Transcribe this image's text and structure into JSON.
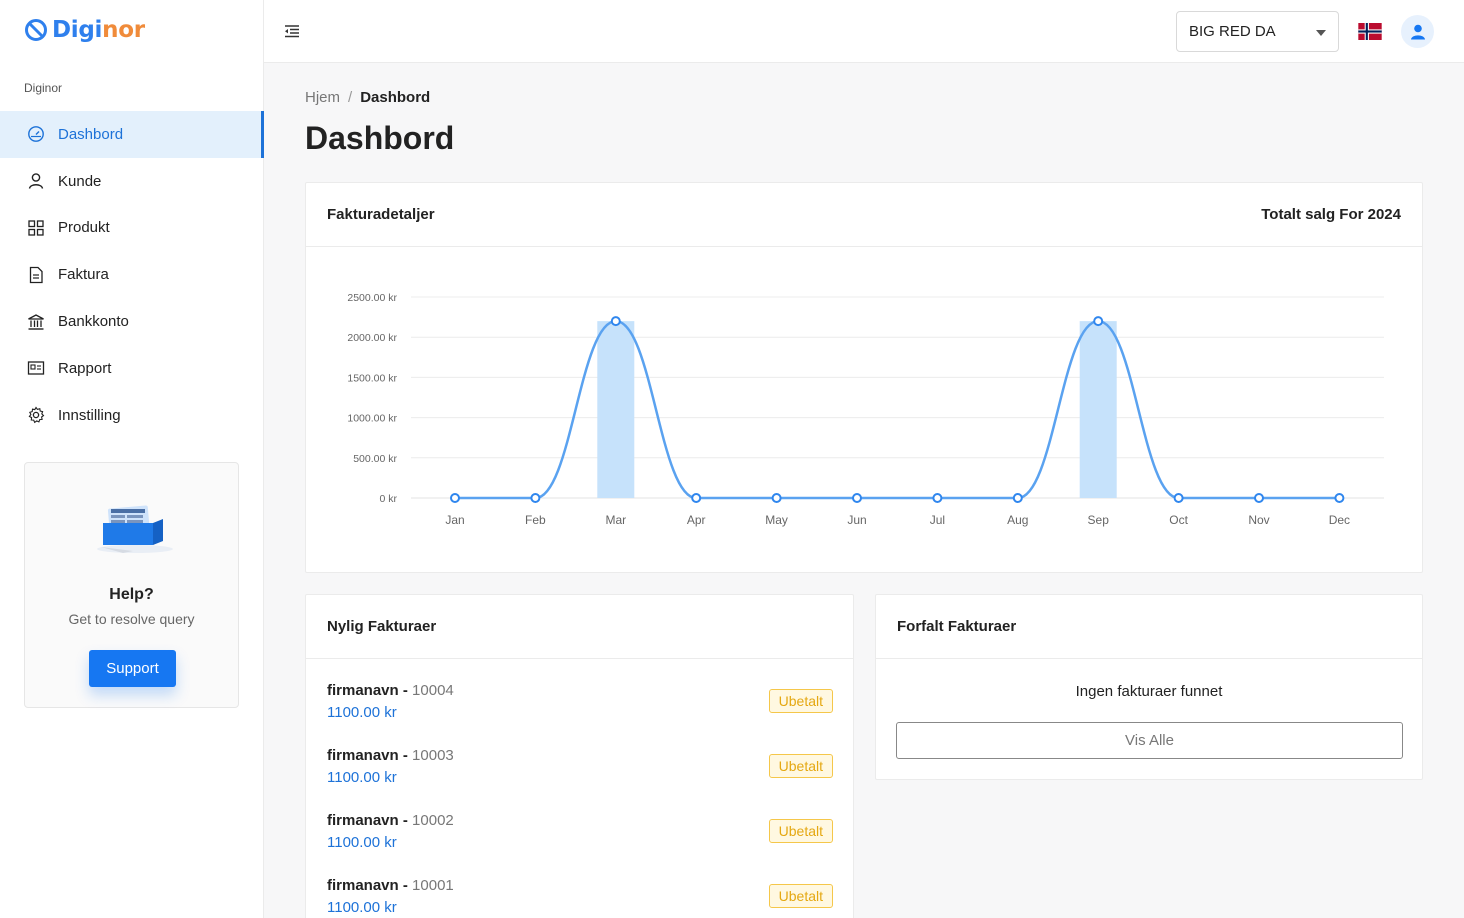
{
  "brand": {
    "logo_part1": "Digi",
    "logo_part2": "nor"
  },
  "sidebar": {
    "section_label": "Diginor",
    "items": [
      {
        "label": "Dashbord",
        "icon": "dashboard-icon",
        "active": true
      },
      {
        "label": "Kunde",
        "icon": "user-icon"
      },
      {
        "label": "Produkt",
        "icon": "grid-icon"
      },
      {
        "label": "Faktura",
        "icon": "document-icon"
      },
      {
        "label": "Bankkonto",
        "icon": "bank-icon"
      },
      {
        "label": "Rapport",
        "icon": "report-icon"
      },
      {
        "label": "Innstilling",
        "icon": "gear-icon"
      }
    ],
    "help": {
      "title": "Help?",
      "subtitle": "Get to resolve query",
      "button": "Support"
    }
  },
  "topbar": {
    "company": "BIG RED DA",
    "language_flag": "norway-flag-icon"
  },
  "breadcrumb": {
    "home": "Hjem",
    "separator": "/",
    "current": "Dashbord"
  },
  "page_title": "Dashbord",
  "chart_card": {
    "title": "Fakturadetaljer",
    "right_title": "Totalt salg For 2024"
  },
  "chart_data": {
    "type": "bar",
    "categories": [
      "Jan",
      "Feb",
      "Mar",
      "Apr",
      "May",
      "Jun",
      "Jul",
      "Aug",
      "Sep",
      "Oct",
      "Nov",
      "Dec"
    ],
    "series": [
      {
        "type": "bar",
        "values": [
          0,
          0,
          2200,
          0,
          0,
          0,
          0,
          0,
          2200,
          0,
          0,
          0
        ]
      },
      {
        "type": "line",
        "smooth": true,
        "values": [
          0,
          0,
          2200,
          0,
          0,
          0,
          0,
          0,
          2200,
          0,
          0,
          0
        ]
      }
    ],
    "ylim": [
      0,
      2500
    ],
    "yticks": [
      "0 kr",
      "500.00 kr",
      "1000.00 kr",
      "1500.00 kr",
      "2000.00 kr",
      "2500.00 kr"
    ],
    "grid": true,
    "colors": {
      "bar": "#c6e2fb",
      "line": "#5aa2f0"
    }
  },
  "recent_invoices": {
    "title": "Nylig Fakturaer",
    "items": [
      {
        "name": "firmanavn",
        "dash": " - ",
        "number": "10004",
        "amount": "1100.00 kr",
        "status": "Ubetalt"
      },
      {
        "name": "firmanavn",
        "dash": " - ",
        "number": "10003",
        "amount": "1100.00 kr",
        "status": "Ubetalt"
      },
      {
        "name": "firmanavn",
        "dash": " - ",
        "number": "10002",
        "amount": "1100.00 kr",
        "status": "Ubetalt"
      },
      {
        "name": "firmanavn",
        "dash": " - ",
        "number": "10001",
        "amount": "1100.00 kr",
        "status": "Ubetalt"
      }
    ]
  },
  "overdue_invoices": {
    "title": "Forfalt Fakturaer",
    "empty": "Ingen fakturaer funnet",
    "button": "Vis Alle"
  }
}
